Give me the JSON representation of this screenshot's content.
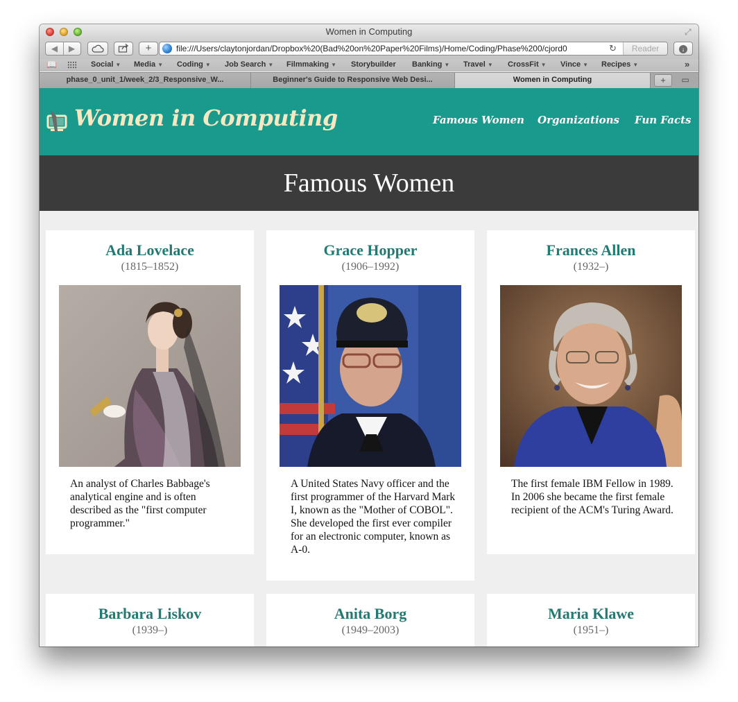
{
  "window": {
    "title": "Women in Computing"
  },
  "toolbar": {
    "url": "file:///Users/claytonjordan/Dropbox%20(Bad%20on%20Paper%20Films)/Home/Coding/Phase%200/cjord0",
    "reader_label": "Reader"
  },
  "bookmarks": [
    {
      "label": "Social",
      "has_menu": true
    },
    {
      "label": "Media",
      "has_menu": true
    },
    {
      "label": "Coding",
      "has_menu": true
    },
    {
      "label": "Job Search",
      "has_menu": true
    },
    {
      "label": "Filmmaking",
      "has_menu": true
    },
    {
      "label": "Storybuilder",
      "has_menu": false
    },
    {
      "label": "Banking",
      "has_menu": true
    },
    {
      "label": "Travel",
      "has_menu": true
    },
    {
      "label": "CrossFit",
      "has_menu": true
    },
    {
      "label": "Vince",
      "has_menu": true
    },
    {
      "label": "Recipes",
      "has_menu": true
    }
  ],
  "tabs": [
    {
      "label": "phase_0_unit_1/week_2/3_Responsive_W...",
      "active": false
    },
    {
      "label": "Beginner's Guide to Responsive Web Desi...",
      "active": false
    },
    {
      "label": "Women in Computing",
      "active": true
    }
  ],
  "site": {
    "logo_text": "Women in Computing",
    "nav": [
      "Famous Women",
      "Organizations",
      "Fun Facts"
    ],
    "banner_title": "Famous Women",
    "colors": {
      "header": "#1a9a8d",
      "banner": "#3b3b3b",
      "name": "#227a73",
      "logo_text": "#f6e9c2"
    }
  },
  "cards": [
    {
      "name": "Ada Lovelace",
      "years": "(1815–1852)",
      "bio": "An analyst of Charles Babbage's analytical engine and is often described as the \"first computer programmer.\""
    },
    {
      "name": "Grace Hopper",
      "years": "(1906–1992)",
      "bio": "A United States Navy officer and the first programmer of the Harvard Mark I, known as the \"Mother of COBOL\". She developed the first ever compiler for an electronic computer, known as A-0."
    },
    {
      "name": "Frances Allen",
      "years": "(1932–)",
      "bio": "The first female IBM Fellow in 1989. In 2006 she became the first female recipient of the ACM's Turing Award."
    },
    {
      "name": "Barbara Liskov",
      "years": "(1939–)",
      "bio": ""
    },
    {
      "name": "Anita Borg",
      "years": "(1949–2003)",
      "bio": ""
    },
    {
      "name": "Maria Klawe",
      "years": "(1951–)",
      "bio": ""
    }
  ]
}
